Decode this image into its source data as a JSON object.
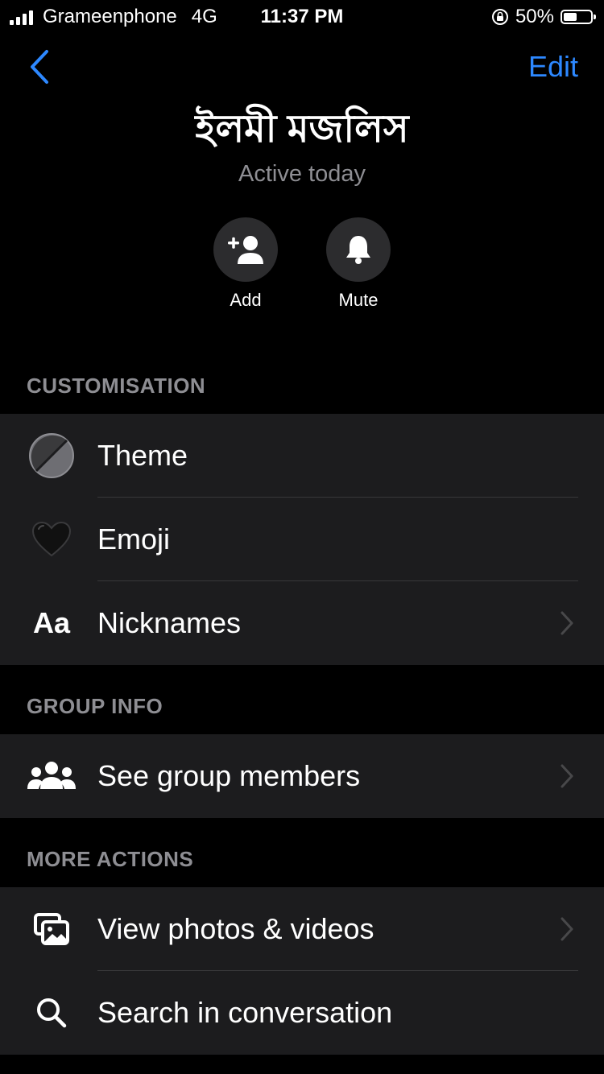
{
  "status_bar": {
    "carrier": "Grameenphone",
    "network": "4G",
    "time": "11:37 PM",
    "battery": "50%",
    "battery_level": 0.5
  },
  "nav": {
    "back_icon": "chevron-left-icon",
    "edit_label": "Edit"
  },
  "header": {
    "title": "ইলমী মজলিস",
    "subtitle": "Active today"
  },
  "actions": [
    {
      "label": "Add",
      "icon": "add-person-icon"
    },
    {
      "label": "Mute",
      "icon": "bell-icon"
    }
  ],
  "sections": {
    "customisation": {
      "header": "CUSTOMISATION",
      "items": [
        {
          "label": "Theme",
          "icon": "theme-circle-icon"
        },
        {
          "label": "Emoji",
          "icon": "black-heart-icon"
        },
        {
          "label": "Nicknames",
          "icon": "text-aa-icon",
          "icon_text": "Aa"
        }
      ]
    },
    "group_info": {
      "header": "GROUP INFO",
      "items": [
        {
          "label": "See group members",
          "icon": "group-people-icon"
        }
      ]
    },
    "more_actions": {
      "header": "MORE ACTIONS",
      "items": [
        {
          "label": "View photos & videos",
          "icon": "photos-icon"
        },
        {
          "label": "Search in conversation",
          "icon": "search-icon"
        }
      ]
    }
  },
  "colors": {
    "accent": "#2d88ff",
    "background": "#000000",
    "row_background": "#1c1c1e",
    "secondary_text": "#8e8e93"
  }
}
